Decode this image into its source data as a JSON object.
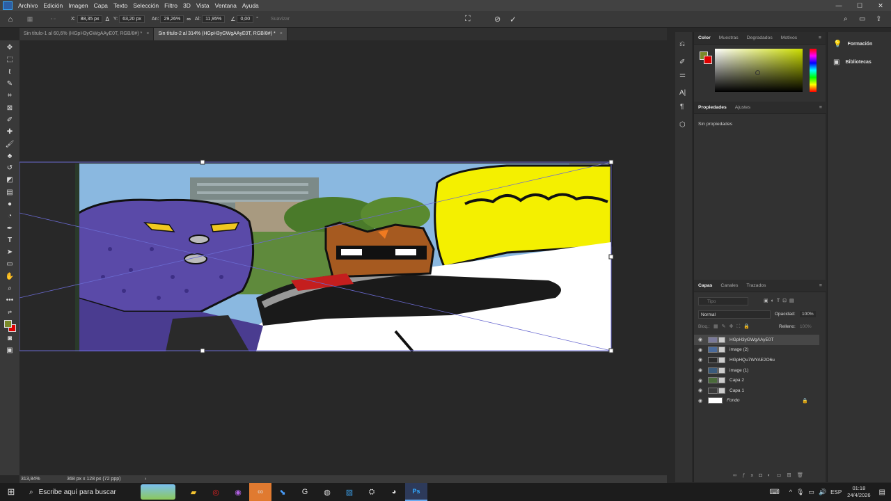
{
  "menubar": {
    "items": [
      "Archivo",
      "Edición",
      "Imagen",
      "Capa",
      "Texto",
      "Selección",
      "Filtro",
      "3D",
      "Vista",
      "Ventana",
      "Ayuda"
    ]
  },
  "options": {
    "x_label": "X:",
    "x_value": "88,35 px",
    "y_label": "Y:",
    "y_value": "63,20 px",
    "w_label": "An:",
    "w_value": "29,26%",
    "h_label": "Al:",
    "h_value": "11,95%",
    "angle_value": "0,00",
    "angle_unit": "°",
    "smooth_label": "Suavizar"
  },
  "tabs": [
    {
      "label": "Sin título-1 al 60,6% (HGpH3yGWgAAyE0T, RGB/8#) *",
      "close": "×"
    },
    {
      "label": "Sin título-2 al 314% (HGpH3yGWgAAyE0T, RGB/8#) *",
      "close": "×"
    }
  ],
  "status": {
    "zoom": "313,84%",
    "doc_size": "368 px x 128 px (72 ppp)"
  },
  "color_panel": {
    "tabs": [
      "Color",
      "Muestras",
      "Degradados",
      "Motivos"
    ],
    "accent": "#ccdd00"
  },
  "properties_panel": {
    "tabs": [
      "Propiedades",
      "Ajustes"
    ],
    "empty_text": "Sin propiedades"
  },
  "layers_panel": {
    "tabs": [
      "Capas",
      "Canales",
      "Trazados"
    ],
    "search_placeholder": "Tipo",
    "blend_mode": "Normal",
    "opacity_label": "Opacidad:",
    "opacity_value": "100%",
    "lock_label": "Bloq.:",
    "fill_label": "Relleno:",
    "fill_value": "100%",
    "layers": [
      {
        "name": "HGpH3yGWgAAyE0T",
        "selected": true
      },
      {
        "name": "image (2)",
        "selected": false
      },
      {
        "name": "HGpHQu7WYAE2O6u",
        "selected": false
      },
      {
        "name": "image (1)",
        "selected": false
      },
      {
        "name": "Capa 2",
        "selected": false
      },
      {
        "name": "Capa 1",
        "selected": false
      },
      {
        "name": "Fondo",
        "selected": false
      }
    ]
  },
  "learn_panel": {
    "items": [
      "Formación",
      "Bibliotecas"
    ]
  },
  "taskbar": {
    "search_placeholder": "Escribe aquí para buscar",
    "lang": "ESP",
    "time": "01:18",
    "date": "24/4/2026"
  }
}
